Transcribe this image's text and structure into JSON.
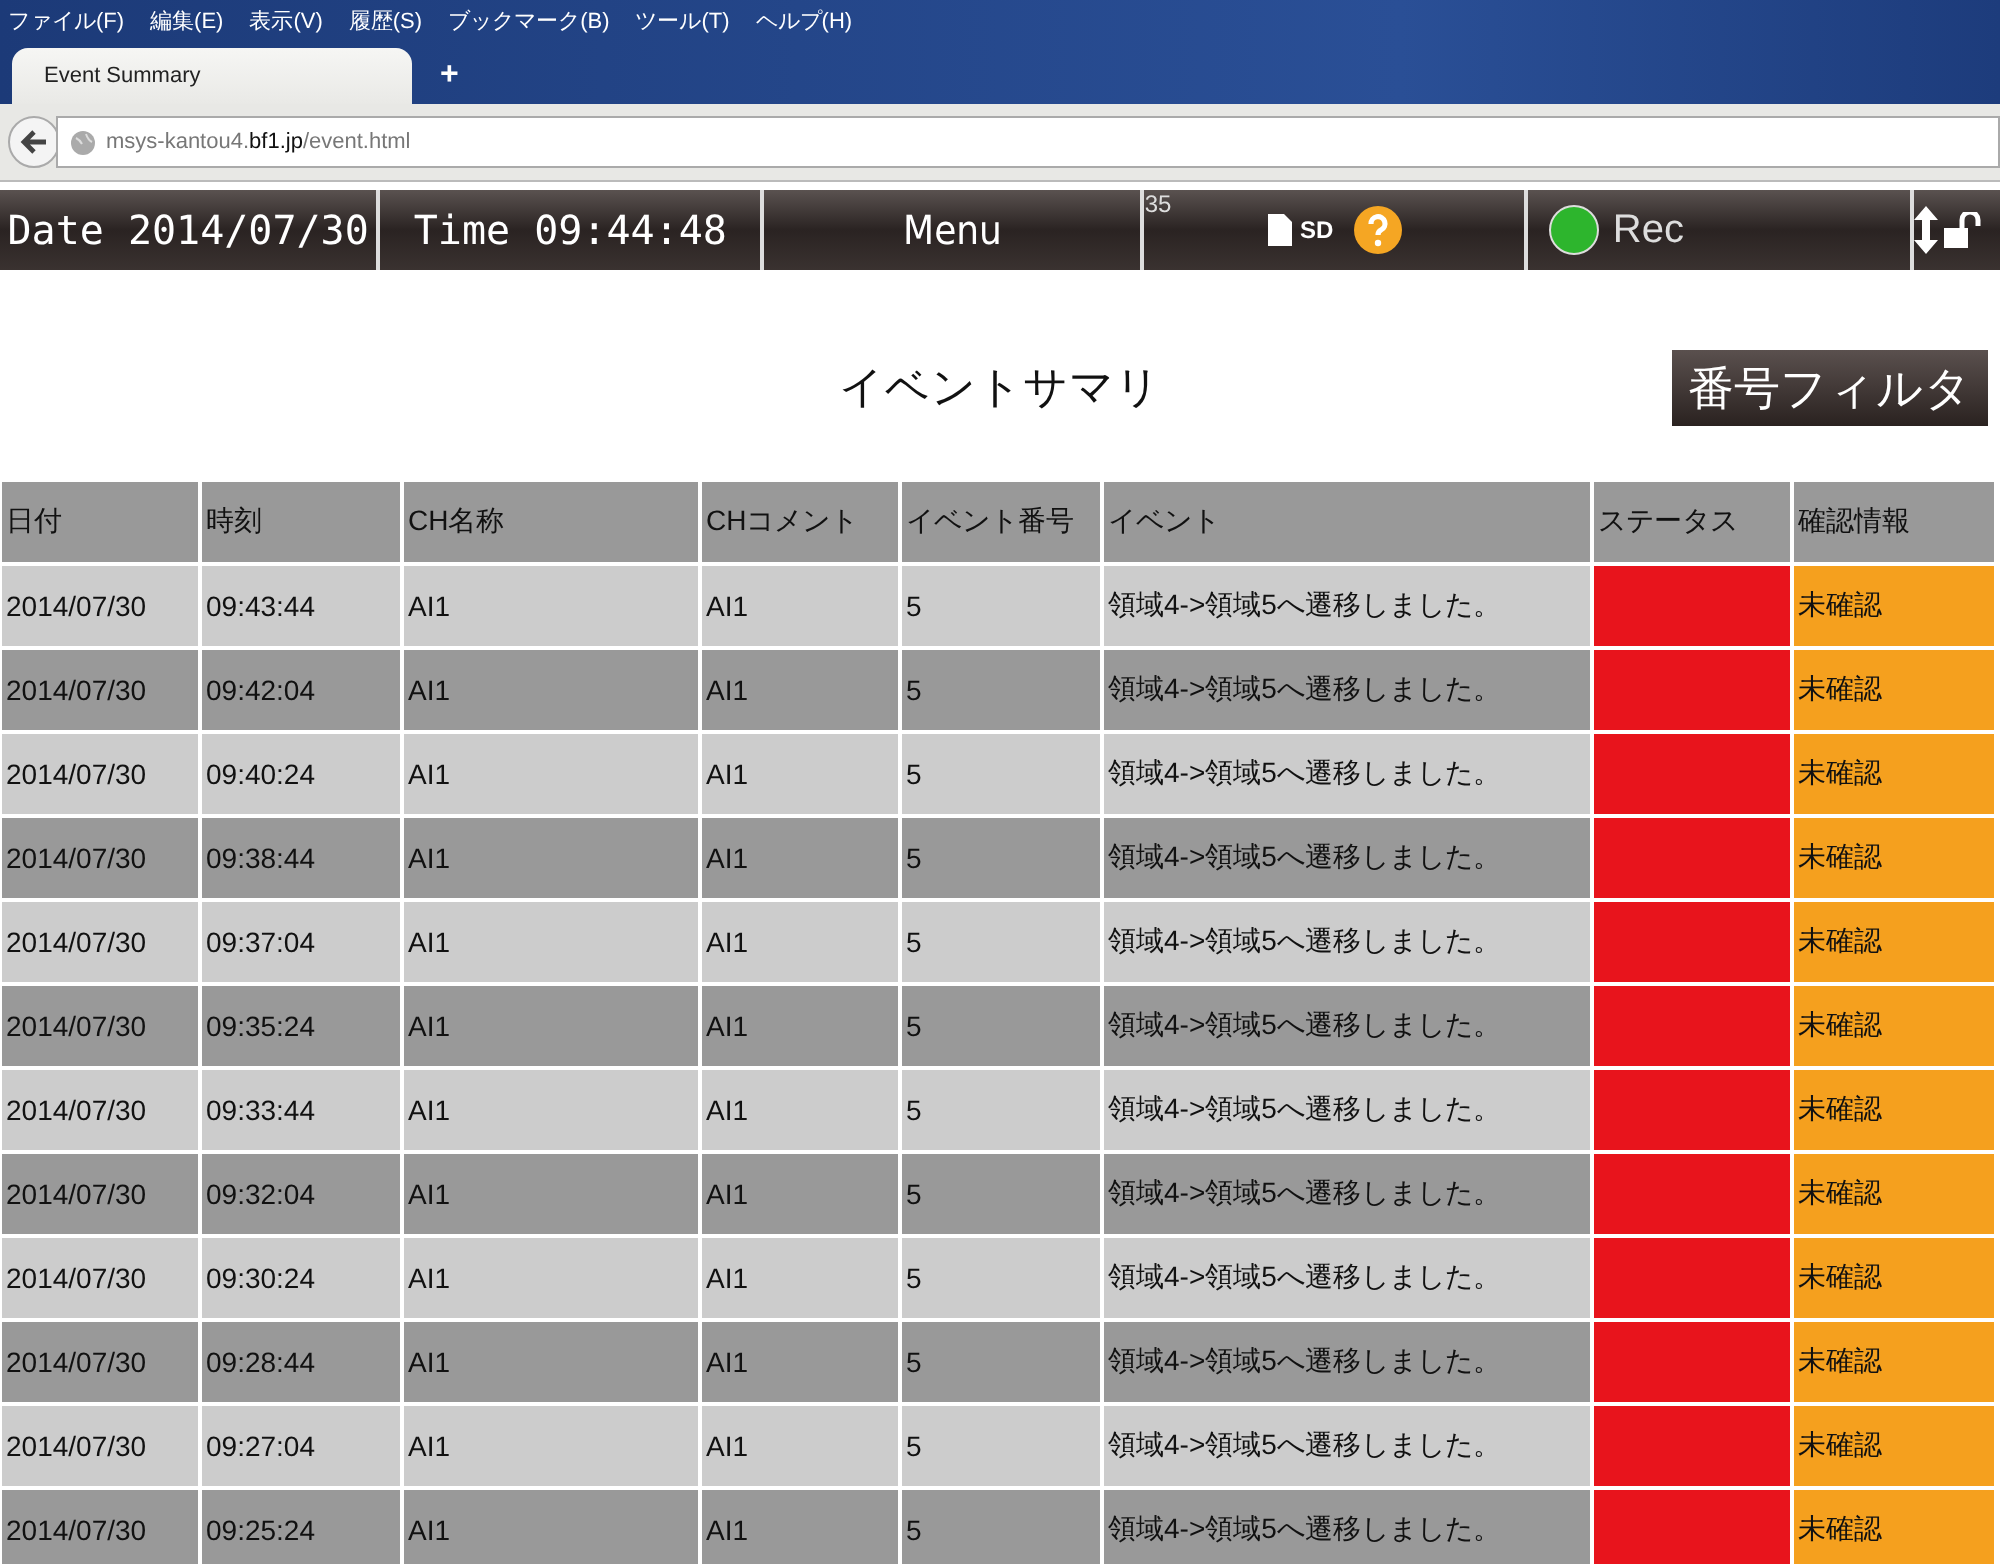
{
  "menu_bar": [
    "ファイル(F)",
    "編集(E)",
    "表示(V)",
    "履歴(S)",
    "ブックマーク(B)",
    "ツール(T)",
    "ヘルプ(H)"
  ],
  "browser": {
    "tab_title": "Event Summary",
    "new_tab": "+",
    "url_host": "msys-kantou4.",
    "url_domain": "bf1.jp",
    "url_path": "/event.html"
  },
  "toolbar": {
    "date": "Date 2014/07/30",
    "time": "Time 09:44:48",
    "menu": "Menu",
    "counter": "35",
    "sd": "SD",
    "rec": "Rec",
    "rec_on": true
  },
  "page": {
    "title": "イベントサマリ",
    "filter_button": "番号フィルタ"
  },
  "table": {
    "columns": [
      "日付",
      "時刻",
      "CH名称",
      "CHコメント",
      "イベント番号",
      "イベント",
      "ステータス",
      "確認情報"
    ],
    "rows": [
      {
        "date": "2014/07/30",
        "time": "09:43:44",
        "ch_name": "AI1",
        "ch_comment": "AI1",
        "event_number": "5",
        "event": "領域4->領域5へ遷移しました。",
        "color": "#e8141c",
        "confirmation": "未確認"
      },
      {
        "date": "2014/07/30",
        "time": "09:42:04",
        "ch_name": "AI1",
        "ch_comment": "AI1",
        "event_number": "5",
        "event": "領域4->領域5へ遷移しました。",
        "color": "#e8141c",
        "confirmation": "未確認"
      },
      {
        "date": "2014/07/30",
        "time": "09:40:24",
        "ch_name": "AI1",
        "ch_comment": "AI1",
        "event_number": "5",
        "event": "領域4->領域5へ遷移しました。",
        "color": "#e8141c",
        "confirmation": "未確認"
      },
      {
        "date": "2014/07/30",
        "time": "09:38:44",
        "ch_name": "AI1",
        "ch_comment": "AI1",
        "event_number": "5",
        "event": "領域4->領域5へ遷移しました。",
        "color": "#e8141c",
        "confirmation": "未確認"
      },
      {
        "date": "2014/07/30",
        "time": "09:37:04",
        "ch_name": "AI1",
        "ch_comment": "AI1",
        "event_number": "5",
        "event": "領域4->領域5へ遷移しました。",
        "color": "#e8141c",
        "confirmation": "未確認"
      },
      {
        "date": "2014/07/30",
        "time": "09:35:24",
        "ch_name": "AI1",
        "ch_comment": "AI1",
        "event_number": "5",
        "event": "領域4->領域5へ遷移しました。",
        "color": "#e8141c",
        "confirmation": "未確認"
      },
      {
        "date": "2014/07/30",
        "time": "09:33:44",
        "ch_name": "AI1",
        "ch_comment": "AI1",
        "event_number": "5",
        "event": "領域4->領域5へ遷移しました。",
        "color": "#e8141c",
        "confirmation": "未確認"
      },
      {
        "date": "2014/07/30",
        "time": "09:32:04",
        "ch_name": "AI1",
        "ch_comment": "AI1",
        "event_number": "5",
        "event": "領域4->領域5へ遷移しました。",
        "color": "#e8141c",
        "confirmation": "未確認"
      },
      {
        "date": "2014/07/30",
        "time": "09:30:24",
        "ch_name": "AI1",
        "ch_comment": "AI1",
        "event_number": "5",
        "event": "領域4->領域5へ遷移しました。",
        "color": "#e8141c",
        "confirmation": "未確認"
      },
      {
        "date": "2014/07/30",
        "time": "09:28:44",
        "ch_name": "AI1",
        "ch_comment": "AI1",
        "event_number": "5",
        "event": "領域4->領域5へ遷移しました。",
        "color": "#e8141c",
        "confirmation": "未確認"
      },
      {
        "date": "2014/07/30",
        "time": "09:27:04",
        "ch_name": "AI1",
        "ch_comment": "AI1",
        "event_number": "5",
        "event": "領域4->領域5へ遷移しました。",
        "color": "#e8141c",
        "confirmation": "未確認"
      },
      {
        "date": "2014/07/30",
        "time": "09:25:24",
        "ch_name": "AI1",
        "ch_comment": "AI1",
        "event_number": "5",
        "event": "領域4->領域5へ遷移しました。",
        "color": "#e8141c",
        "confirmation": "未確認"
      }
    ]
  }
}
